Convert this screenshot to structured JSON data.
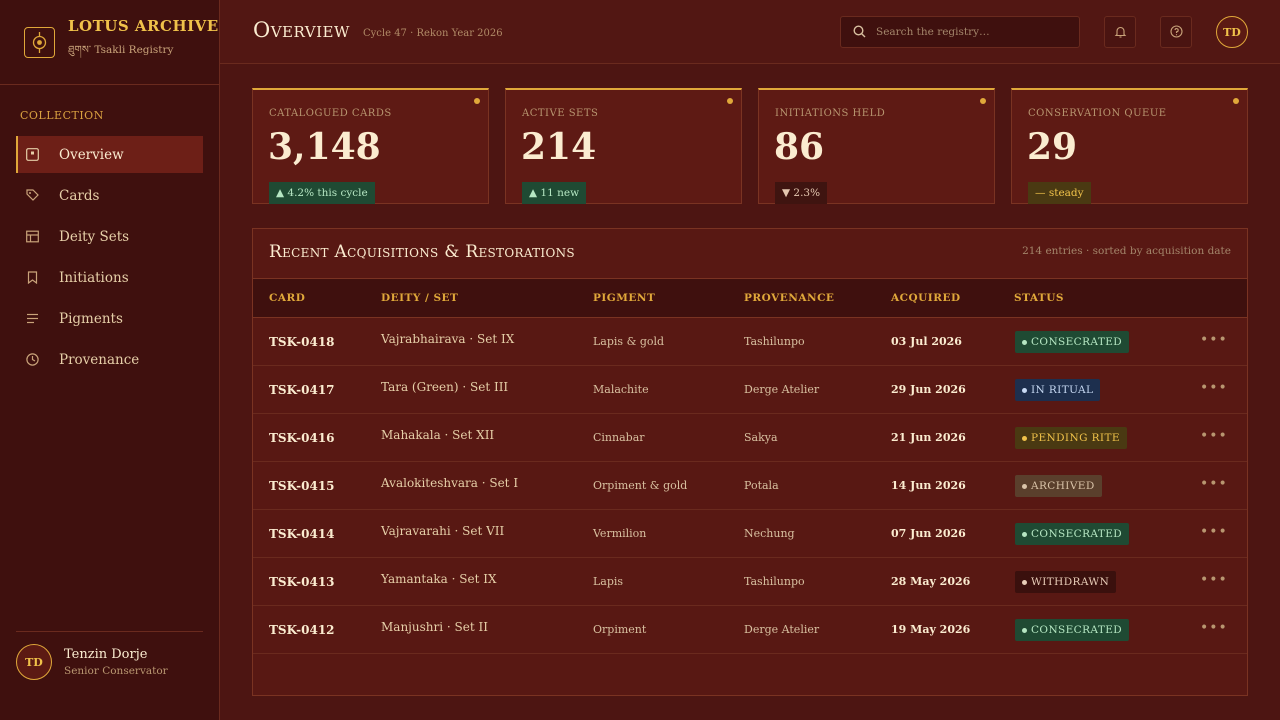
{
  "brand": {
    "title": "LOTUS ARCHIVE",
    "subtitle": "ཐུགས་ Tsakli Registry"
  },
  "sidebar": {
    "section": "COLLECTION",
    "items": [
      {
        "label": "Overview",
        "icon": "overview-icon",
        "active": true
      },
      {
        "label": "Cards",
        "icon": "tag-icon"
      },
      {
        "label": "Deity Sets",
        "icon": "layout-icon"
      },
      {
        "label": "Initiations",
        "icon": "bookmark-icon"
      },
      {
        "label": "Pigments",
        "icon": "lines-icon"
      },
      {
        "label": "Provenance",
        "icon": "clock-icon"
      }
    ],
    "user": {
      "initials": "TD",
      "name": "Tenzin Dorje",
      "role": "Senior Conservator"
    }
  },
  "header": {
    "title": "Overview",
    "subtitle": "Cycle 47 · Rekon Year 2026",
    "search_placeholder": "Search the registry…",
    "avatar": "TD"
  },
  "stats": [
    {
      "label": "CATALOGUED CARDS",
      "value": "3,148",
      "trend": "▲ 4.2% this cycle",
      "kind": "up"
    },
    {
      "label": "ACTIVE SETS",
      "value": "214",
      "trend": "▲ 11 new",
      "kind": "up"
    },
    {
      "label": "INITIATIONS HELD",
      "value": "86",
      "trend": "▼ 2.3%",
      "kind": "down"
    },
    {
      "label": "CONSERVATION QUEUE",
      "value": "29",
      "trend": "— steady",
      "kind": "steady"
    }
  ],
  "table": {
    "title": "Recent Acquisitions & Restorations",
    "meta": "214 entries · sorted by acquisition date",
    "columns": [
      "CARD",
      "DEITY / SET",
      "PIGMENT",
      "PROVENANCE",
      "ACQUIRED",
      "STATUS"
    ],
    "rows": [
      {
        "card": "TSK-0418",
        "deity": "Vajrabhairava · Set IX",
        "pigment": "Lapis & gold",
        "provenance": "Tashilunpo",
        "acquired": "03 Jul 2026",
        "status": "CONSECRATED",
        "kind": "consecrated"
      },
      {
        "card": "TSK-0417",
        "deity": "Tara (Green) · Set III",
        "pigment": "Malachite",
        "provenance": "Derge Atelier",
        "acquired": "29 Jun 2026",
        "status": "IN RITUAL",
        "kind": "ritual"
      },
      {
        "card": "TSK-0416",
        "deity": "Mahakala · Set XII",
        "pigment": "Cinnabar",
        "provenance": "Sakya",
        "acquired": "21 Jun 2026",
        "status": "PENDING RITE",
        "kind": "pending"
      },
      {
        "card": "TSK-0415",
        "deity": "Avalokiteshvara · Set I",
        "pigment": "Orpiment & gold",
        "provenance": "Potala",
        "acquired": "14 Jun 2026",
        "status": "ARCHIVED",
        "kind": "archived"
      },
      {
        "card": "TSK-0414",
        "deity": "Vajravarahi · Set VII",
        "pigment": "Vermilion",
        "provenance": "Nechung",
        "acquired": "07 Jun 2026",
        "status": "CONSECRATED",
        "kind": "consecrated"
      },
      {
        "card": "TSK-0413",
        "deity": "Yamantaka · Set IX",
        "pigment": "Lapis",
        "provenance": "Tashilunpo",
        "acquired": "28 May 2026",
        "status": "WITHDRAWN",
        "kind": "withdrawn"
      },
      {
        "card": "TSK-0412",
        "deity": "Manjushri · Set II",
        "pigment": "Orpiment",
        "provenance": "Derge Atelier",
        "acquired": "19 May 2026",
        "status": "CONSECRATED",
        "kind": "consecrated"
      }
    ]
  },
  "colors": {
    "accent": "#e0a83a",
    "background": "#4d1512",
    "sidebar": "#3f100e"
  }
}
